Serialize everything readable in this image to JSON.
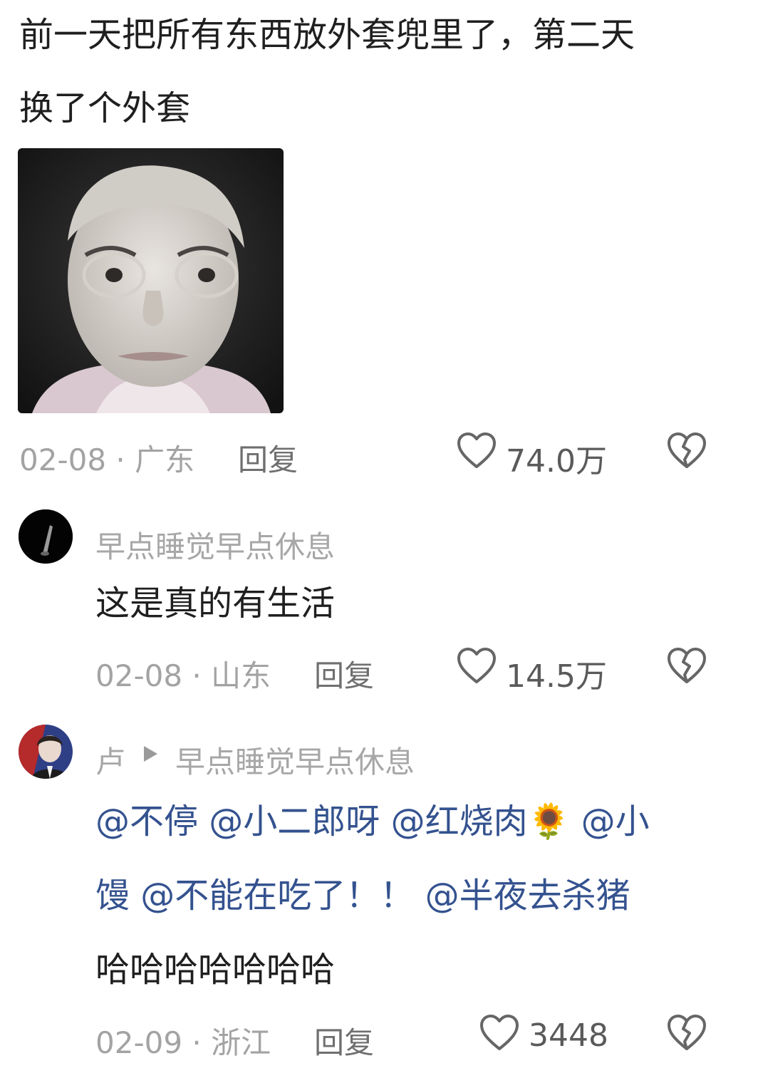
{
  "top_comment": {
    "line1": "前一天把所有东西放外套兜里了，第二天",
    "line2": "换了个外套",
    "meta": "02-08 · 广东",
    "reply_label": "回复",
    "like_count": "74.0万"
  },
  "reply1": {
    "username": "早点睡觉早点休息",
    "text": "这是真的有生活",
    "meta": "02-08 · 山东",
    "reply_label": "回复",
    "like_count": "14.5万"
  },
  "reply2": {
    "username": "卢",
    "reply_to": "早点睡觉早点休息",
    "mentions": {
      "m1": "@不停",
      "m2": "@小二郎呀",
      "m3": "@红烧肉",
      "m4": "@小",
      "m4b": "馒",
      "m5": "@不能在吃了！！",
      "m6": "@半夜去杀猪"
    },
    "sunflower": "🌻",
    "text_tail": "哈哈哈哈哈哈哈",
    "meta": "02-09 · 浙江",
    "reply_label": "回复",
    "like_count": "3448"
  },
  "icons": {
    "like": "heart-outline-icon",
    "dislike": "broken-heart-icon"
  },
  "colors": {
    "mention": "#34528f",
    "meta": "#a3a3a3"
  }
}
